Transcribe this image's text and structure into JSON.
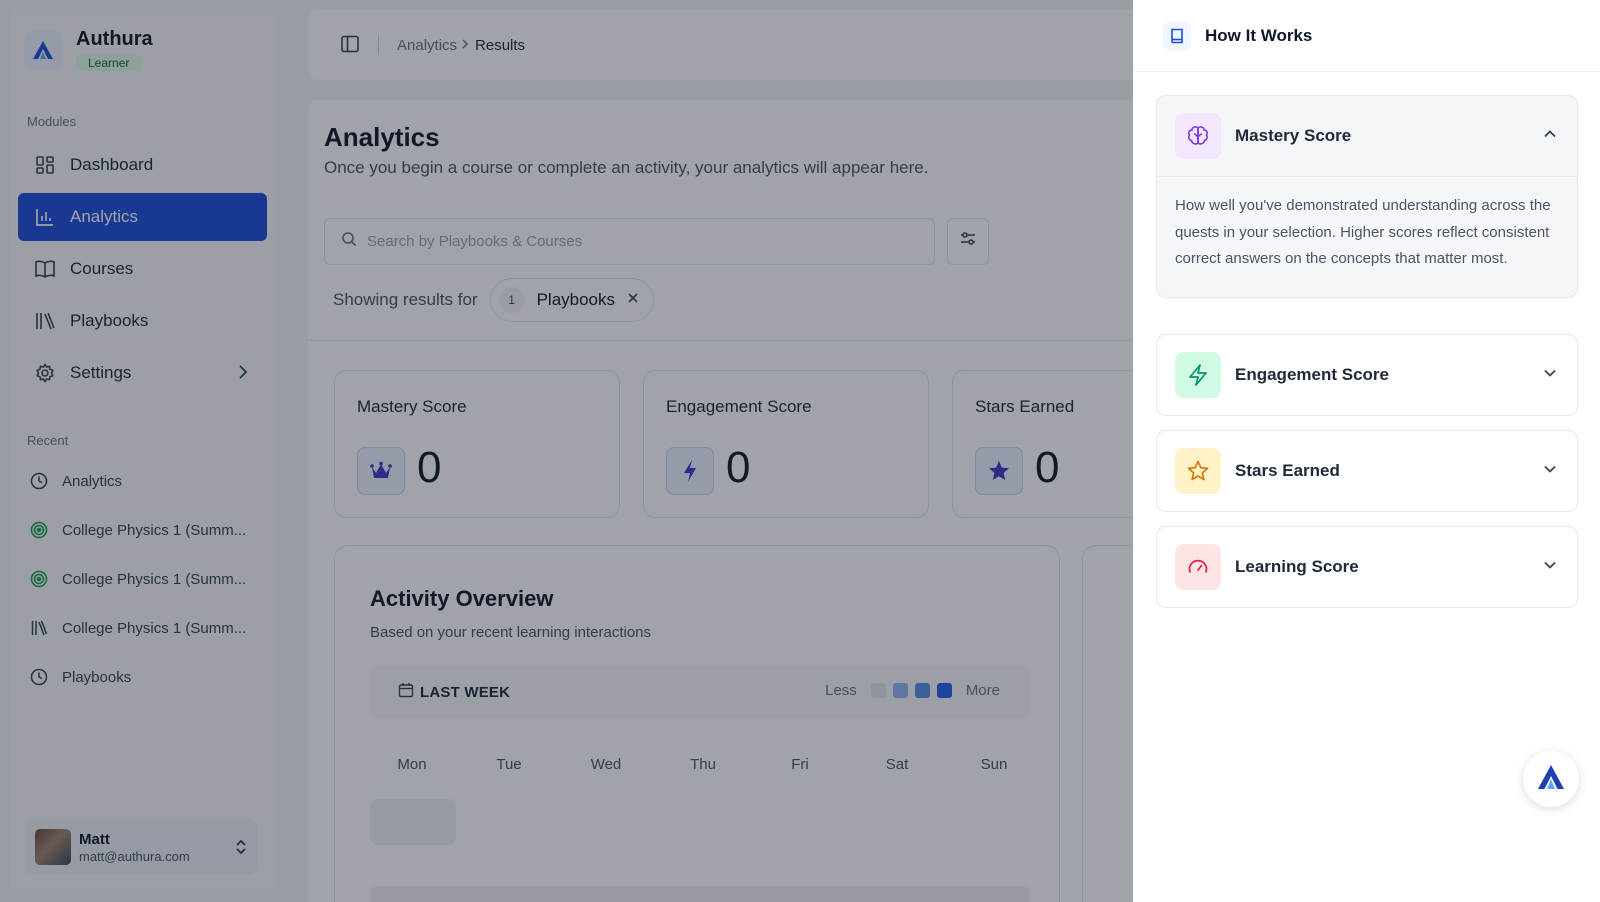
{
  "brand": {
    "name": "Authura",
    "role": "Learner"
  },
  "sidebar": {
    "modules_label": "Modules",
    "items": [
      {
        "label": "Dashboard",
        "icon": "dashboard-icon"
      },
      {
        "label": "Analytics",
        "icon": "bar-chart-icon",
        "active": true
      },
      {
        "label": "Courses",
        "icon": "book-open-icon"
      },
      {
        "label": "Playbooks",
        "icon": "library-icon"
      },
      {
        "label": "Settings",
        "icon": "gear-icon",
        "has_submenu": true
      }
    ],
    "recent_label": "Recent",
    "recent": [
      {
        "label": "Analytics",
        "icon": "clock-icon"
      },
      {
        "label": "College Physics 1 (Summ...",
        "icon": "target-icon"
      },
      {
        "label": "College Physics 1 (Summ...",
        "icon": "target-icon"
      },
      {
        "label": "College Physics 1 (Summ...",
        "icon": "library-icon"
      },
      {
        "label": "Playbooks",
        "icon": "clock-icon"
      }
    ]
  },
  "user": {
    "name": "Matt",
    "email": "matt@authura.com"
  },
  "breadcrumb": {
    "parent": "Analytics",
    "current": "Results"
  },
  "page": {
    "title": "Analytics",
    "subtitle": "Once you begin a course or complete an activity, your analytics will appear here."
  },
  "search": {
    "placeholder": "Search by Playbooks & Courses"
  },
  "filters": {
    "label": "Showing results for",
    "chip_count": "1",
    "chip_label": "Playbooks"
  },
  "stats": [
    {
      "title": "Mastery Score",
      "value": "0",
      "icon": "crown-icon"
    },
    {
      "title": "Engagement Score",
      "value": "0",
      "icon": "lightning-icon"
    },
    {
      "title": "Stars Earned",
      "value": "0",
      "icon": "star-icon"
    }
  ],
  "activity": {
    "title": "Activity Overview",
    "subtitle": "Based on your recent learning interactions",
    "period": "LAST WEEK",
    "legend_less": "Less",
    "legend_more": "More",
    "legend_colors": [
      "#e5e7eb",
      "#93b4f5",
      "#5b8ee8",
      "#2563eb"
    ],
    "days": [
      "Mon",
      "Tue",
      "Wed",
      "Thu",
      "Fri",
      "Sat",
      "Sun"
    ]
  },
  "drawer": {
    "title": "How It Works",
    "items": [
      {
        "title": "Mastery Score",
        "icon": "brain-icon",
        "expanded": true,
        "body": "How well you've demonstrated understanding across the quests in your selection. Higher scores reflect consistent correct answers on the concepts that matter most."
      },
      {
        "title": "Engagement Score",
        "icon": "lightning-icon",
        "expanded": false
      },
      {
        "title": "Stars Earned",
        "icon": "star-icon",
        "expanded": false
      },
      {
        "title": "Learning Score",
        "icon": "gauge-icon",
        "expanded": false
      }
    ]
  },
  "colors": {
    "accent": "#1d4ed8",
    "learner_badge": "#dcfce7",
    "engagement": "#10b981",
    "stars": "#f59e0b",
    "learning": "#e11d48",
    "mastery": "#7c3aed"
  }
}
